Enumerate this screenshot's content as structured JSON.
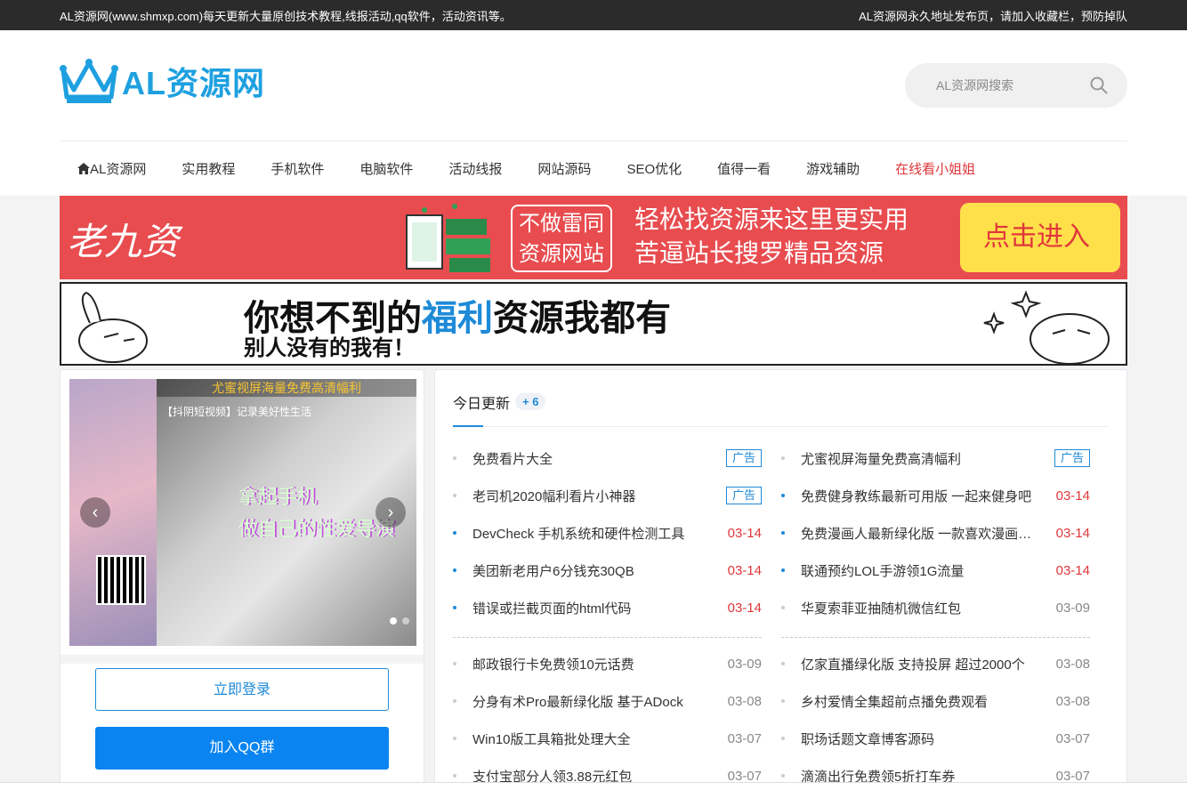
{
  "topbar": {
    "left": "AL资源网(www.shmxp.com)每天更新大量原创技术教程,线报活动,qq软件，活动资讯等。",
    "right": "AL资源网永久地址发布页，请加入收藏栏，预防掉队"
  },
  "logo": {
    "text": "AL资源网"
  },
  "search": {
    "placeholder": "AL资源网搜索"
  },
  "nav": [
    {
      "label": "AL资源网"
    },
    {
      "label": "实用教程"
    },
    {
      "label": "手机软件"
    },
    {
      "label": "电脑软件"
    },
    {
      "label": "活动线报"
    },
    {
      "label": "网站源码"
    },
    {
      "label": "SEO优化"
    },
    {
      "label": "值得一看"
    },
    {
      "label": "游戏辅助"
    },
    {
      "label": "在线看小姐姐"
    }
  ],
  "banner1": {
    "left_text": "老九资",
    "box_line1": "不做雷同",
    "box_line2": "资源网站",
    "mid_line1": "轻松找资源来这里更实用",
    "mid_line2": "苦逼站长搜罗精品资源",
    "enter": "点击进入"
  },
  "banner2": {
    "t1_a": "你想不到的",
    "t1_hl": "福利",
    "t1_b": "资源我都有",
    "t2": "别人没有的我有！"
  },
  "slider": {
    "caption": "尤蜜视屏海量免费高清幅利",
    "sub": "【抖阴短视频】记录美好性生活",
    "overlay1": "拿起手机",
    "overlay2": "做自己的性爱导演",
    "prev": "‹",
    "next": "›"
  },
  "buttons": {
    "login": "立即登录",
    "qq": "加入QQ群"
  },
  "today": {
    "title": "今日更新",
    "badge": "+ 6"
  },
  "left_list_top": [
    {
      "text": "免费看片大全",
      "meta": "广告",
      "type": "ad",
      "dot": "gray"
    },
    {
      "text": "老司机2020幅利看片小神器",
      "meta": "广告",
      "type": "ad",
      "dot": "gray"
    },
    {
      "text": "DevCheck 手机系统和硬件检测工具",
      "meta": "03-14",
      "type": "red",
      "dot": "blue"
    },
    {
      "text": "美团新老用户6分钱充30QB",
      "meta": "03-14",
      "type": "red",
      "dot": "blue"
    },
    {
      "text": "错误或拦截页面的html代码",
      "meta": "03-14",
      "type": "red",
      "dot": "blue"
    }
  ],
  "right_list_top": [
    {
      "text": "尤蜜视屏海量免费高清幅利",
      "meta": "广告",
      "type": "ad",
      "dot": "gray"
    },
    {
      "text": "免费健身教练最新可用版 一起来健身吧",
      "meta": "03-14",
      "type": "red",
      "dot": "blue"
    },
    {
      "text": "免费漫画人最新绿化版 一款喜欢漫画的必备",
      "meta": "03-14",
      "type": "red",
      "dot": "blue"
    },
    {
      "text": "联通预约LOL手游领1G流量",
      "meta": "03-14",
      "type": "red",
      "dot": "blue"
    },
    {
      "text": "华夏索菲亚抽随机微信红包",
      "meta": "03-09",
      "type": "gray",
      "dot": "gray"
    }
  ],
  "left_list_bottom": [
    {
      "text": "邮政银行卡免费领10元话费",
      "meta": "03-09"
    },
    {
      "text": "分身有术Pro最新绿化版 基于ADock",
      "meta": "03-08"
    },
    {
      "text": "Win10版工具箱批处理大全",
      "meta": "03-07"
    },
    {
      "text": "支付宝部分人领3.88元红包",
      "meta": "03-07"
    }
  ],
  "right_list_bottom": [
    {
      "text": "亿家直播绿化版 支持投屏 超过2000个",
      "meta": "03-08"
    },
    {
      "text": "乡村爱情全集超前点播免费观看",
      "meta": "03-08"
    },
    {
      "text": "职场话题文章博客源码",
      "meta": "03-07"
    },
    {
      "text": "滴滴出行免费领5折打车券",
      "meta": "03-07"
    }
  ],
  "colors": {
    "brand": "#1ea0e0",
    "accent": "#1e8ad8",
    "red": "#e0373a",
    "qq_button": "#0a84f0"
  }
}
